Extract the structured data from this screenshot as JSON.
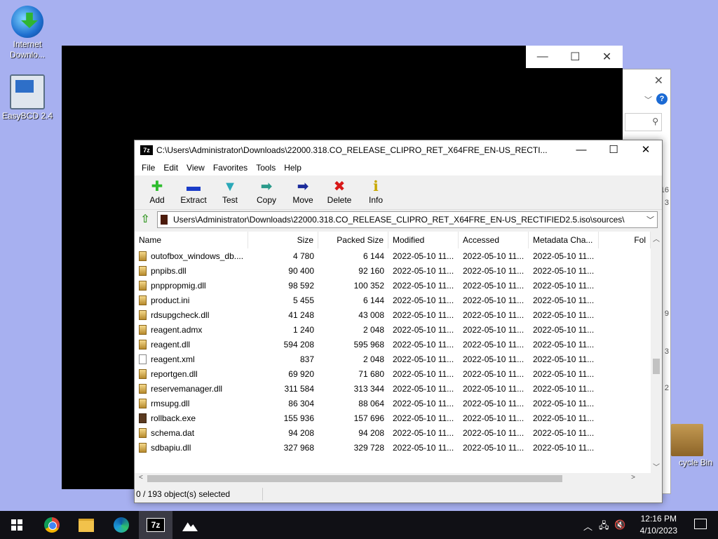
{
  "desktop": {
    "icons": [
      {
        "label": "Internet Downlo...",
        "icon": "internet-download-manager-icon"
      },
      {
        "label": "EasyBCD 2.4",
        "icon": "easybcd-icon"
      },
      {
        "label": "cycle Bin",
        "icon": "recycle-bin-icon"
      }
    ]
  },
  "background_explorer": {
    "side_numbers": [
      "16",
      "3",
      "9",
      "3",
      "2"
    ]
  },
  "window": {
    "title": "C:\\Users\\Administrator\\Downloads\\22000.318.CO_RELEASE_CLIPRO_RET_X64FRE_EN-US_RECTI...",
    "app_icon_text": "7z",
    "controls": {
      "minimize": "—",
      "maximize": "☐",
      "close": "✕"
    }
  },
  "menu": [
    "File",
    "Edit",
    "View",
    "Favorites",
    "Tools",
    "Help"
  ],
  "toolbar": [
    {
      "label": "Add",
      "icon": "add-icon",
      "color": "#2ebd2e",
      "glyph": "✚"
    },
    {
      "label": "Extract",
      "icon": "extract-icon",
      "color": "#1a3cc8",
      "glyph": "▬"
    },
    {
      "label": "Test",
      "icon": "test-icon",
      "color": "#2aa8b8",
      "glyph": "▼"
    },
    {
      "label": "Copy",
      "icon": "copy-icon",
      "color": "#2a9a8a",
      "glyph": "➡"
    },
    {
      "label": "Move",
      "icon": "move-icon",
      "color": "#1a2a9a",
      "glyph": "➡"
    },
    {
      "label": "Delete",
      "icon": "delete-icon",
      "color": "#d81818",
      "glyph": "✖"
    },
    {
      "label": "Info",
      "icon": "info-icon",
      "color": "#c8a800",
      "glyph": "ℹ"
    }
  ],
  "address": {
    "path": "Users\\Administrator\\Downloads\\22000.318.CO_RELEASE_CLIPRO_RET_X64FRE_EN-US_RECTIFIED2.5.iso\\sources\\"
  },
  "columns": [
    "Name",
    "Size",
    "Packed Size",
    "Modified",
    "Accessed",
    "Metadata Cha...",
    "Fol"
  ],
  "files": [
    {
      "name": "outofbox_windows_db....",
      "size": "4 780",
      "packed": "6 144",
      "modified": "2022-05-10 11...",
      "accessed": "2022-05-10 11...",
      "metadata": "2022-05-10 11...",
      "type": "dll"
    },
    {
      "name": "pnpibs.dll",
      "size": "90 400",
      "packed": "92 160",
      "modified": "2022-05-10 11...",
      "accessed": "2022-05-10 11...",
      "metadata": "2022-05-10 11...",
      "type": "dll"
    },
    {
      "name": "pnppropmig.dll",
      "size": "98 592",
      "packed": "100 352",
      "modified": "2022-05-10 11...",
      "accessed": "2022-05-10 11...",
      "metadata": "2022-05-10 11...",
      "type": "dll"
    },
    {
      "name": "product.ini",
      "size": "5 455",
      "packed": "6 144",
      "modified": "2022-05-10 11...",
      "accessed": "2022-05-10 11...",
      "metadata": "2022-05-10 11...",
      "type": "dll"
    },
    {
      "name": "rdsupgcheck.dll",
      "size": "41 248",
      "packed": "43 008",
      "modified": "2022-05-10 11...",
      "accessed": "2022-05-10 11...",
      "metadata": "2022-05-10 11...",
      "type": "dll"
    },
    {
      "name": "reagent.admx",
      "size": "1 240",
      "packed": "2 048",
      "modified": "2022-05-10 11...",
      "accessed": "2022-05-10 11...",
      "metadata": "2022-05-10 11...",
      "type": "dll"
    },
    {
      "name": "reagent.dll",
      "size": "594 208",
      "packed": "595 968",
      "modified": "2022-05-10 11...",
      "accessed": "2022-05-10 11...",
      "metadata": "2022-05-10 11...",
      "type": "dll"
    },
    {
      "name": "reagent.xml",
      "size": "837",
      "packed": "2 048",
      "modified": "2022-05-10 11...",
      "accessed": "2022-05-10 11...",
      "metadata": "2022-05-10 11...",
      "type": "xml"
    },
    {
      "name": "reportgen.dll",
      "size": "69 920",
      "packed": "71 680",
      "modified": "2022-05-10 11...",
      "accessed": "2022-05-10 11...",
      "metadata": "2022-05-10 11...",
      "type": "dll"
    },
    {
      "name": "reservemanager.dll",
      "size": "311 584",
      "packed": "313 344",
      "modified": "2022-05-10 11...",
      "accessed": "2022-05-10 11...",
      "metadata": "2022-05-10 11...",
      "type": "dll"
    },
    {
      "name": "rmsupg.dll",
      "size": "86 304",
      "packed": "88 064",
      "modified": "2022-05-10 11...",
      "accessed": "2022-05-10 11...",
      "metadata": "2022-05-10 11...",
      "type": "dll"
    },
    {
      "name": "rollback.exe",
      "size": "155 936",
      "packed": "157 696",
      "modified": "2022-05-10 11...",
      "accessed": "2022-05-10 11...",
      "metadata": "2022-05-10 11...",
      "type": "exe"
    },
    {
      "name": "schema.dat",
      "size": "94 208",
      "packed": "94 208",
      "modified": "2022-05-10 11...",
      "accessed": "2022-05-10 11...",
      "metadata": "2022-05-10 11...",
      "type": "dll"
    },
    {
      "name": "sdbapiu.dll",
      "size": "327 968",
      "packed": "329 728",
      "modified": "2022-05-10 11...",
      "accessed": "2022-05-10 11...",
      "metadata": "2022-05-10 11...",
      "type": "dll"
    }
  ],
  "status": {
    "selected": "0 / 193 object(s) selected"
  },
  "taskbar": {
    "apps": [
      "start-icon",
      "chrome-icon",
      "file-explorer-icon",
      "edge-icon",
      "7zip-icon",
      "photos-icon"
    ],
    "clock_time": "12:16 PM",
    "clock_date": "4/10/2023"
  }
}
